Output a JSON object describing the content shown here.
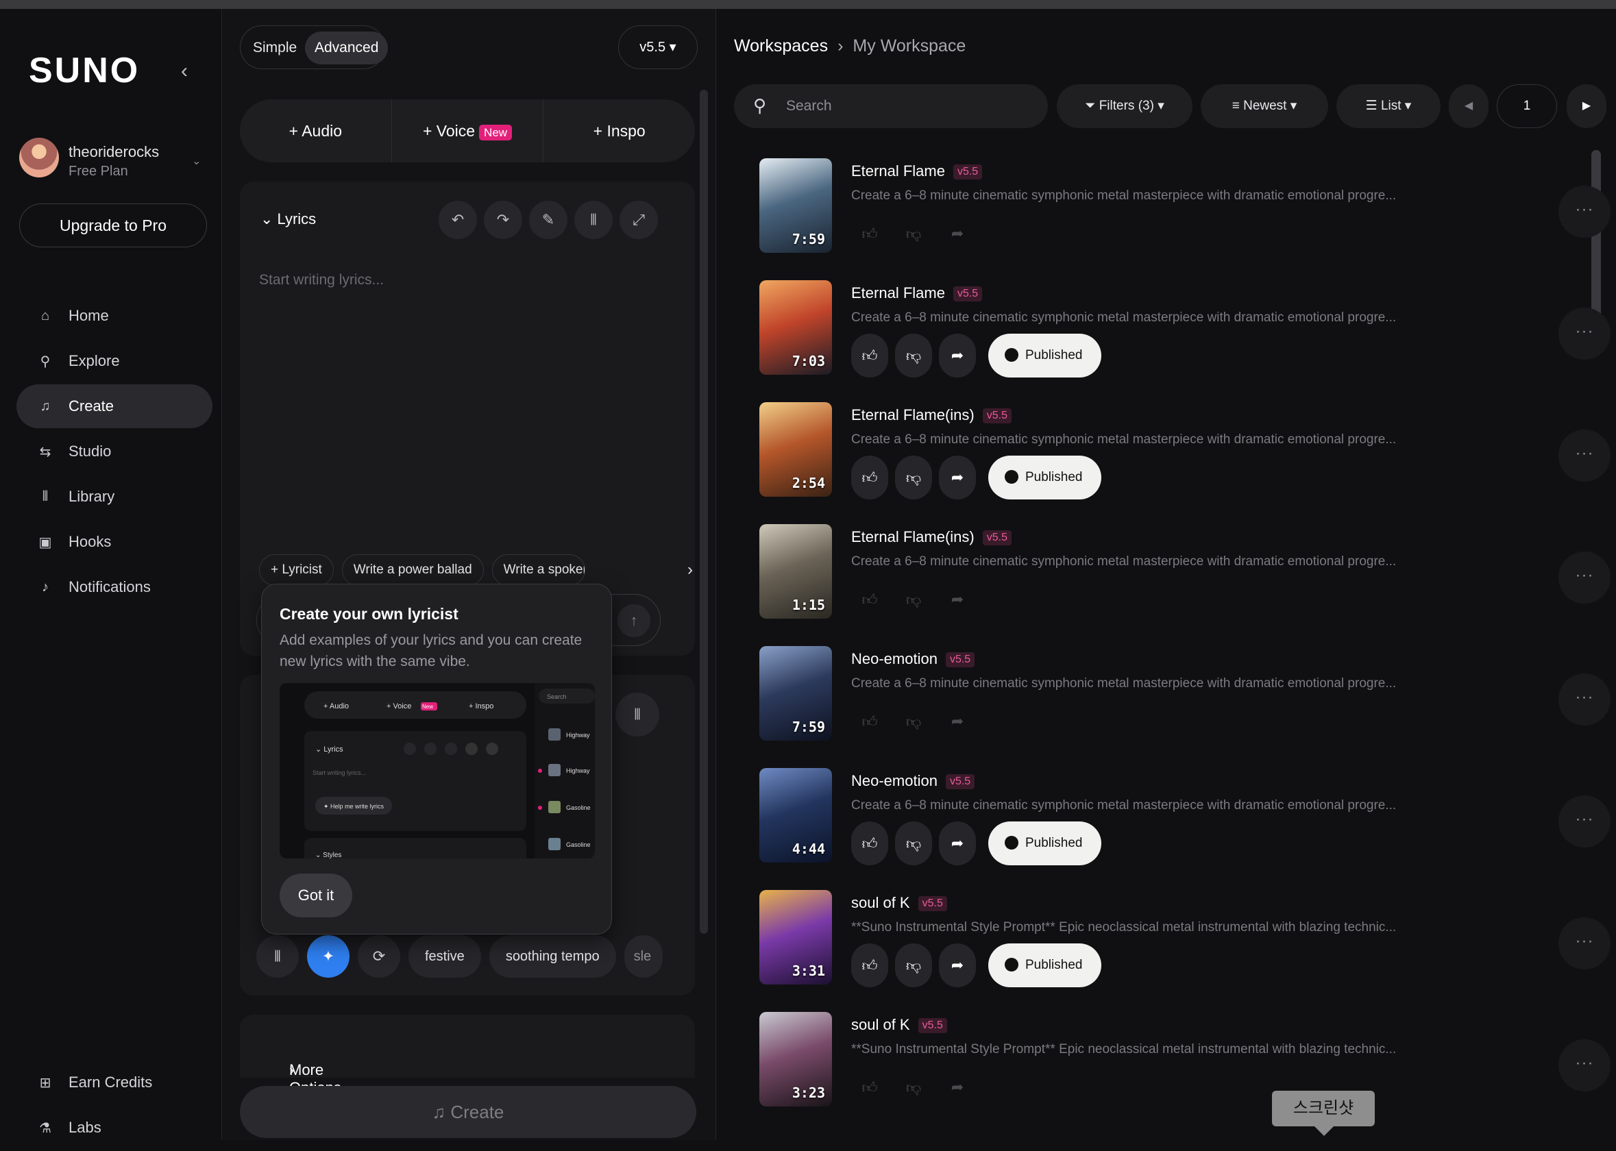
{
  "sidebar": {
    "logo": "SUNO",
    "collapse_icon": "‹",
    "user": {
      "name": "theoriderocks",
      "plan": "Free Plan"
    },
    "upgrade": "Upgrade to Pro",
    "nav": [
      {
        "label": "Home",
        "icon": "home-icon",
        "glyph": "⌂"
      },
      {
        "label": "Explore",
        "icon": "search-icon",
        "glyph": "⚲"
      },
      {
        "label": "Create",
        "icon": "create-music-icon",
        "glyph": "♫"
      },
      {
        "label": "Studio",
        "icon": "studio-icon",
        "glyph": "⇆"
      },
      {
        "label": "Library",
        "icon": "library-icon",
        "glyph": "⫴"
      },
      {
        "label": "Hooks",
        "icon": "hooks-icon",
        "glyph": "▣"
      },
      {
        "label": "Notifications",
        "icon": "bell-icon",
        "glyph": "♪"
      }
    ],
    "bottom": [
      {
        "label": "Earn Credits",
        "icon": "gift-icon",
        "glyph": "⊞"
      },
      {
        "label": "Labs",
        "icon": "flask-icon",
        "glyph": "⚗"
      }
    ]
  },
  "create_panel": {
    "mode": {
      "simple": "Simple",
      "advanced": "Advanced"
    },
    "version": "v5.5",
    "add": {
      "audio": "Audio",
      "voice": "Voice",
      "voice_badge": "New",
      "inspo": "Inspo"
    },
    "lyrics": {
      "title": "Lyrics",
      "placeholder": "Start writing lyrics..."
    },
    "chips": [
      "Lyricist",
      "Write a power ballad",
      "Write a spoken wo"
    ],
    "style_tags": [
      "festive",
      "soothing tempo",
      "sle"
    ],
    "more_options": "More Options",
    "create": "Create"
  },
  "popover": {
    "title": "Create your own lyricist",
    "description": "Add examples of your lyrics and you can create new lyrics with the same vibe.",
    "preview": {
      "audio": "Audio",
      "voice": "Voice",
      "new": "New",
      "inspo": "Inspo",
      "lyrics": "Lyrics",
      "placeholder": "Start writing lyrics...",
      "help": "Help me write lyrics",
      "styles": "Styles",
      "search": "Search",
      "items": [
        "Highway",
        "Highway",
        "Gasoline",
        "Gasoline"
      ]
    },
    "button": "Got it"
  },
  "workspace": {
    "breadcrumb": {
      "root": "Workspaces",
      "current": "My Workspace"
    },
    "search_placeholder": "Search",
    "filters": "Filters (3)",
    "sort": "Newest",
    "view": "List",
    "page": "1",
    "songs": [
      {
        "title": "Eternal Flame",
        "version": "v5.5",
        "duration": "7:59",
        "desc": "Create a 6–8 minute cinematic symphonic metal masterpiece with dramatic emotional progre...",
        "published": false,
        "thumb": [
          "#e4ecf2",
          "#4a6680",
          "#1a2330"
        ]
      },
      {
        "title": "Eternal Flame",
        "version": "v5.5",
        "duration": "7:03",
        "desc": "Create a 6–8 minute cinematic symphonic metal masterpiece with dramatic emotional progre...",
        "published": true,
        "published_label": "Published",
        "thumb": [
          "#f0a860",
          "#c0442a",
          "#1b1c26"
        ]
      },
      {
        "title": "Eternal Flame(ins)",
        "version": "v5.5",
        "duration": "2:54",
        "desc": "Create a 6–8 minute cinematic symphonic metal masterpiece with dramatic emotional progre...",
        "published": true,
        "published_label": "Published",
        "thumb": [
          "#f2cf8a",
          "#b4562a",
          "#3a2214"
        ]
      },
      {
        "title": "Eternal Flame(ins)",
        "version": "v5.5",
        "duration": "1:15",
        "desc": "Create a 6–8 minute cinematic symphonic metal masterpiece with dramatic emotional progre...",
        "published": false,
        "thumb": [
          "#cfc9bc",
          "#6a6356",
          "#2a2722"
        ]
      },
      {
        "title": "Neo-emotion",
        "version": "v5.5",
        "duration": "7:59",
        "desc": "Create a 6–8 minute cinematic symphonic metal masterpiece with dramatic emotional progre...",
        "published": false,
        "thumb": [
          "#8aa0c8",
          "#2c3a5c",
          "#0e1220"
        ]
      },
      {
        "title": "Neo-emotion",
        "version": "v5.5",
        "duration": "4:44",
        "desc": "Create a 6–8 minute cinematic symphonic metal masterpiece with dramatic emotional progre...",
        "published": true,
        "published_label": "Published",
        "thumb": [
          "#6f8bc4",
          "#23355e",
          "#0b1328"
        ]
      },
      {
        "title": "soul of K",
        "version": "v5.5",
        "duration": "3:31",
        "desc": "**Suno Instrumental Style Prompt** Epic neoclassical metal instrumental with blazing technic...",
        "published": true,
        "published_label": "Published",
        "thumb": [
          "#e8b24a",
          "#7a3aa8",
          "#1c1030"
        ]
      },
      {
        "title": "soul of K",
        "version": "v5.5",
        "duration": "3:23",
        "desc": "**Suno Instrumental Style Prompt** Epic neoclassical metal instrumental with blazing technic...",
        "published": false,
        "thumb": [
          "#c9c9d2",
          "#7a4b6a",
          "#1a1418"
        ]
      }
    ]
  },
  "screenshot_tooltip": "스크린샷"
}
